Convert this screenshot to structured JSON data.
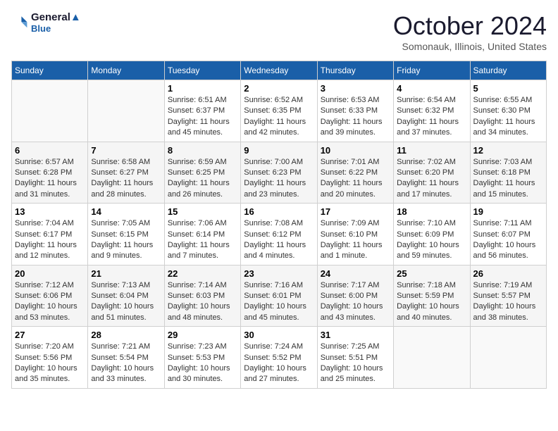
{
  "header": {
    "logo_line1": "General",
    "logo_line2": "Blue",
    "month": "October 2024",
    "location": "Somonauk, Illinois, United States"
  },
  "weekdays": [
    "Sunday",
    "Monday",
    "Tuesday",
    "Wednesday",
    "Thursday",
    "Friday",
    "Saturday"
  ],
  "weeks": [
    [
      {
        "day": "",
        "info": ""
      },
      {
        "day": "",
        "info": ""
      },
      {
        "day": "1",
        "info": "Sunrise: 6:51 AM\nSunset: 6:37 PM\nDaylight: 11 hours and 45 minutes."
      },
      {
        "day": "2",
        "info": "Sunrise: 6:52 AM\nSunset: 6:35 PM\nDaylight: 11 hours and 42 minutes."
      },
      {
        "day": "3",
        "info": "Sunrise: 6:53 AM\nSunset: 6:33 PM\nDaylight: 11 hours and 39 minutes."
      },
      {
        "day": "4",
        "info": "Sunrise: 6:54 AM\nSunset: 6:32 PM\nDaylight: 11 hours and 37 minutes."
      },
      {
        "day": "5",
        "info": "Sunrise: 6:55 AM\nSunset: 6:30 PM\nDaylight: 11 hours and 34 minutes."
      }
    ],
    [
      {
        "day": "6",
        "info": "Sunrise: 6:57 AM\nSunset: 6:28 PM\nDaylight: 11 hours and 31 minutes."
      },
      {
        "day": "7",
        "info": "Sunrise: 6:58 AM\nSunset: 6:27 PM\nDaylight: 11 hours and 28 minutes."
      },
      {
        "day": "8",
        "info": "Sunrise: 6:59 AM\nSunset: 6:25 PM\nDaylight: 11 hours and 26 minutes."
      },
      {
        "day": "9",
        "info": "Sunrise: 7:00 AM\nSunset: 6:23 PM\nDaylight: 11 hours and 23 minutes."
      },
      {
        "day": "10",
        "info": "Sunrise: 7:01 AM\nSunset: 6:22 PM\nDaylight: 11 hours and 20 minutes."
      },
      {
        "day": "11",
        "info": "Sunrise: 7:02 AM\nSunset: 6:20 PM\nDaylight: 11 hours and 17 minutes."
      },
      {
        "day": "12",
        "info": "Sunrise: 7:03 AM\nSunset: 6:18 PM\nDaylight: 11 hours and 15 minutes."
      }
    ],
    [
      {
        "day": "13",
        "info": "Sunrise: 7:04 AM\nSunset: 6:17 PM\nDaylight: 11 hours and 12 minutes."
      },
      {
        "day": "14",
        "info": "Sunrise: 7:05 AM\nSunset: 6:15 PM\nDaylight: 11 hours and 9 minutes."
      },
      {
        "day": "15",
        "info": "Sunrise: 7:06 AM\nSunset: 6:14 PM\nDaylight: 11 hours and 7 minutes."
      },
      {
        "day": "16",
        "info": "Sunrise: 7:08 AM\nSunset: 6:12 PM\nDaylight: 11 hours and 4 minutes."
      },
      {
        "day": "17",
        "info": "Sunrise: 7:09 AM\nSunset: 6:10 PM\nDaylight: 11 hours and 1 minute."
      },
      {
        "day": "18",
        "info": "Sunrise: 7:10 AM\nSunset: 6:09 PM\nDaylight: 10 hours and 59 minutes."
      },
      {
        "day": "19",
        "info": "Sunrise: 7:11 AM\nSunset: 6:07 PM\nDaylight: 10 hours and 56 minutes."
      }
    ],
    [
      {
        "day": "20",
        "info": "Sunrise: 7:12 AM\nSunset: 6:06 PM\nDaylight: 10 hours and 53 minutes."
      },
      {
        "day": "21",
        "info": "Sunrise: 7:13 AM\nSunset: 6:04 PM\nDaylight: 10 hours and 51 minutes."
      },
      {
        "day": "22",
        "info": "Sunrise: 7:14 AM\nSunset: 6:03 PM\nDaylight: 10 hours and 48 minutes."
      },
      {
        "day": "23",
        "info": "Sunrise: 7:16 AM\nSunset: 6:01 PM\nDaylight: 10 hours and 45 minutes."
      },
      {
        "day": "24",
        "info": "Sunrise: 7:17 AM\nSunset: 6:00 PM\nDaylight: 10 hours and 43 minutes."
      },
      {
        "day": "25",
        "info": "Sunrise: 7:18 AM\nSunset: 5:59 PM\nDaylight: 10 hours and 40 minutes."
      },
      {
        "day": "26",
        "info": "Sunrise: 7:19 AM\nSunset: 5:57 PM\nDaylight: 10 hours and 38 minutes."
      }
    ],
    [
      {
        "day": "27",
        "info": "Sunrise: 7:20 AM\nSunset: 5:56 PM\nDaylight: 10 hours and 35 minutes."
      },
      {
        "day": "28",
        "info": "Sunrise: 7:21 AM\nSunset: 5:54 PM\nDaylight: 10 hours and 33 minutes."
      },
      {
        "day": "29",
        "info": "Sunrise: 7:23 AM\nSunset: 5:53 PM\nDaylight: 10 hours and 30 minutes."
      },
      {
        "day": "30",
        "info": "Sunrise: 7:24 AM\nSunset: 5:52 PM\nDaylight: 10 hours and 27 minutes."
      },
      {
        "day": "31",
        "info": "Sunrise: 7:25 AM\nSunset: 5:51 PM\nDaylight: 10 hours and 25 minutes."
      },
      {
        "day": "",
        "info": ""
      },
      {
        "day": "",
        "info": ""
      }
    ]
  ]
}
